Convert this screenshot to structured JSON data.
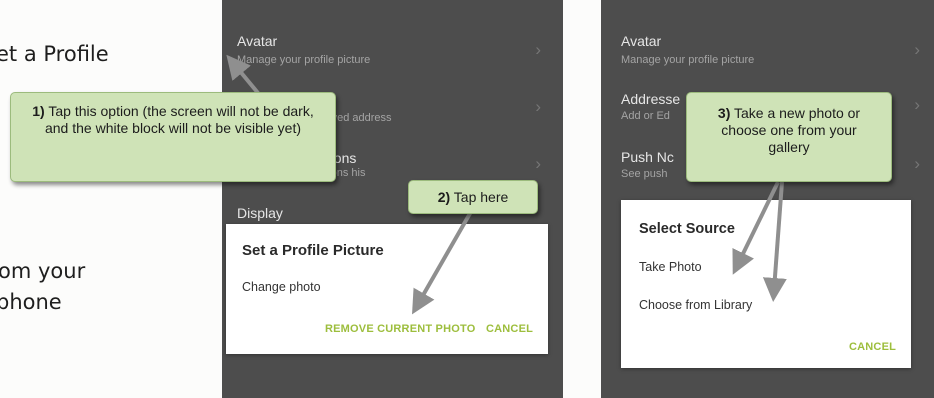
{
  "intro": {
    "line1": "et a Profile",
    "line2": "om your",
    "line3": "phone"
  },
  "phone1": {
    "rows": [
      {
        "title": "Avatar",
        "subtitle": "Manage your profile picture"
      },
      {
        "title": "",
        "subtitle": "saved address"
      },
      {
        "title": "ations",
        "subtitle": "ations his"
      },
      {
        "title": "Display",
        "subtitle": ""
      }
    ],
    "dialog": {
      "title": "Set a Profile Picture",
      "item": "Change photo",
      "remove_label": "REMOVE CURRENT PHOTO",
      "cancel_label": "CANCEL"
    }
  },
  "phone2": {
    "rows": [
      {
        "title": "Avatar",
        "subtitle": "Manage your profile picture"
      },
      {
        "title": "Addresse",
        "subtitle": "Add or Ed"
      },
      {
        "title": "Push Nc",
        "subtitle": "See push"
      }
    ],
    "dialog": {
      "title": "Select Source",
      "items": [
        "Take Photo",
        "Choose from Library"
      ],
      "cancel_label": "CANCEL"
    }
  },
  "callouts": {
    "c1": {
      "num": "1)",
      "text": "Tap this option (the screen will not be dark, and the white block will not be visible yet)"
    },
    "c2": {
      "num": "2)",
      "text": "Tap here"
    },
    "c3": {
      "num": "3)",
      "text": "Take a new photo or choose one from your gallery"
    }
  },
  "icons": {
    "chevron": "chevron-right-icon",
    "arrow": "pointer-arrow"
  },
  "colors": {
    "screen_bg": "#4d4d4d",
    "dialog_bg": "#ffffff",
    "action_green": "#9dbe3d",
    "callout_bg": "#cfe3b7",
    "arrow_gray": "#8f8f8f"
  }
}
